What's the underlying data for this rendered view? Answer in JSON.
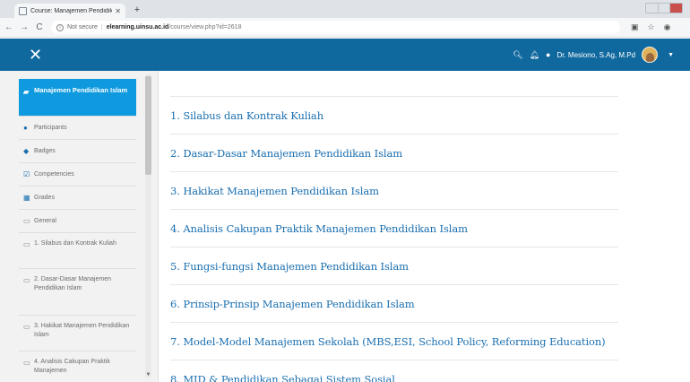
{
  "browser": {
    "tab_title": "Course: Manajemen Pendidikan",
    "tab_close": "✕",
    "new_tab": "+",
    "not_secure": "Not secure",
    "url_host": "elearning.uinsu.ac.id",
    "url_path": "/course/view.php?id=2618"
  },
  "navbar": {
    "user_name": "Dr. Mesiono, S.Ag, M.Pd"
  },
  "drawer": {
    "course": "Manajemen Pendidikan Islam",
    "items": [
      {
        "label": "Participants",
        "icon": "participants-icon"
      },
      {
        "label": "Badges",
        "icon": "badge-icon"
      },
      {
        "label": "Competencies",
        "icon": "competencies-icon"
      },
      {
        "label": "Grades",
        "icon": "grades-icon"
      },
      {
        "label": "General",
        "icon": "folder-icon"
      },
      {
        "label": "1. Silabus dan Kontrak Kuliah",
        "icon": "folder-icon"
      },
      {
        "label": "2. Dasar-Dasar Manajemen Pendidikan Islam",
        "icon": "folder-icon"
      },
      {
        "label": "3. Hakikat Manajemen Pendidikan Islam",
        "icon": "folder-icon"
      },
      {
        "label": "4. Analisis Cakupan Praktik Manajemen",
        "icon": "folder-icon"
      }
    ]
  },
  "topics": [
    "1. Silabus dan Kontrak Kuliah",
    "2. Dasar-Dasar Manajemen Pendidikan Islam",
    "3. Hakikat Manajemen Pendidikan Islam",
    "4. Analisis Cakupan Praktik Manajemen Pendidikan Islam",
    "5. Fungsi-fungsi Manajemen Pendidikan Islam",
    "6. Prinsip-Prinsip Manajemen Pendidikan Islam",
    "7. Model-Model Manajemen Sekolah (MBS,ESI, School Policy, Reforming Education)",
    "8. MID & Pendidikan Sebagai Sistem Sosial"
  ],
  "colors": {
    "navbar": "#10699e",
    "active_item": "#0f9ae0",
    "link": "#1a6fb0"
  }
}
